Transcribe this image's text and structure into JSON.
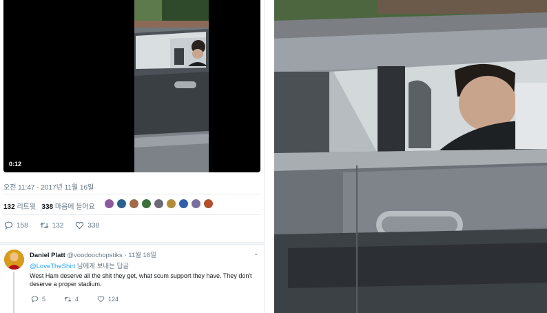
{
  "video": {
    "time": "0:12"
  },
  "tweet": {
    "timestamp": "오전 11:47 - 2017년 11월 16일",
    "retweet_count": "132",
    "retweet_label": "리트윗",
    "like_count": "338",
    "like_label": "마음에 들어요",
    "liker_colors": [
      "#8a5b9b",
      "#2b5f8c",
      "#a06a4c",
      "#3c6f3a",
      "#6a6a78",
      "#b48a3c",
      "#2f5fa8",
      "#7b6fa0",
      "#b2502c"
    ],
    "actions": {
      "reply_count": "158",
      "retweet_count": "132",
      "like_count": "338"
    }
  },
  "reply": {
    "name": "Daniel Platt",
    "handle": "@voodoochopstiks",
    "separator": "·",
    "date": "11월 16일",
    "reply_to_handle": "@LoveTheShirt",
    "reply_to_suffix": "님에게 보내는 답글",
    "text": "West Ham deserve all the shit they get, what scum support they have. They don't deserve a proper stadium.",
    "actions": {
      "reply_count": "5",
      "retweet_count": "4",
      "like_count": "124"
    }
  },
  "colors": {
    "link": "#1da1f2",
    "muted": "#657786",
    "divider": "#e6ecf0"
  },
  "icons": [
    "reply-icon",
    "retweet-icon",
    "like-icon",
    "caret-down-icon"
  ]
}
